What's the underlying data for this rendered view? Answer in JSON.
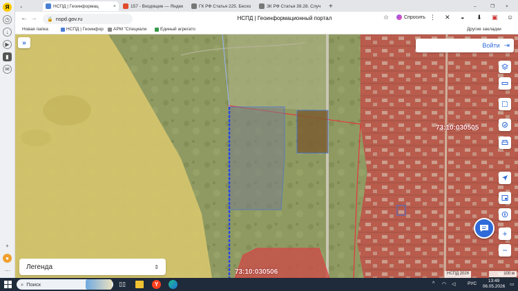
{
  "browser": {
    "tabs": [
      {
        "label": "НСПД | Геоинформац",
        "active": true,
        "favicon_color": "#4a7fd4"
      },
      {
        "label": "157 - Входящие — Яндек",
        "active": false,
        "favicon_color": "#e04b2c"
      },
      {
        "label": "ГК РФ Статья 225. Бесхо",
        "active": false,
        "favicon_color": "#666"
      },
      {
        "label": "ЗК РФ Статья 39.28. Случ",
        "active": false,
        "favicon_color": "#666"
      }
    ],
    "url": "nspd.gov.ru",
    "page_title": "НСПД | Геоинформационный портал",
    "ask_label": "Спросить",
    "bookmarks": [
      {
        "label": "Новая папка"
      },
      {
        "label": "НСПД | Геоинфор"
      },
      {
        "label": "АРМ \"Специали"
      },
      {
        "label": "Единый агрегато"
      }
    ],
    "other_bookmarks": "Другие закладки"
  },
  "map": {
    "login_label": "Войти",
    "legend_label": "Легенда",
    "cadastral_labels": [
      "73:10:030505",
      "73:10:030506"
    ],
    "attribution": "НСПД 2026",
    "scale_label": "100 м",
    "colors": {
      "field_yellow": "#d8c66a",
      "parcel_red": "#e8343f",
      "quarter_red_fill": "#c9504a",
      "parcel_blue": "#3b6fe0"
    }
  },
  "taskbar": {
    "search_placeholder": "Поиск",
    "lang": "РУС",
    "time": "13:49",
    "date": "06.05.2026"
  }
}
